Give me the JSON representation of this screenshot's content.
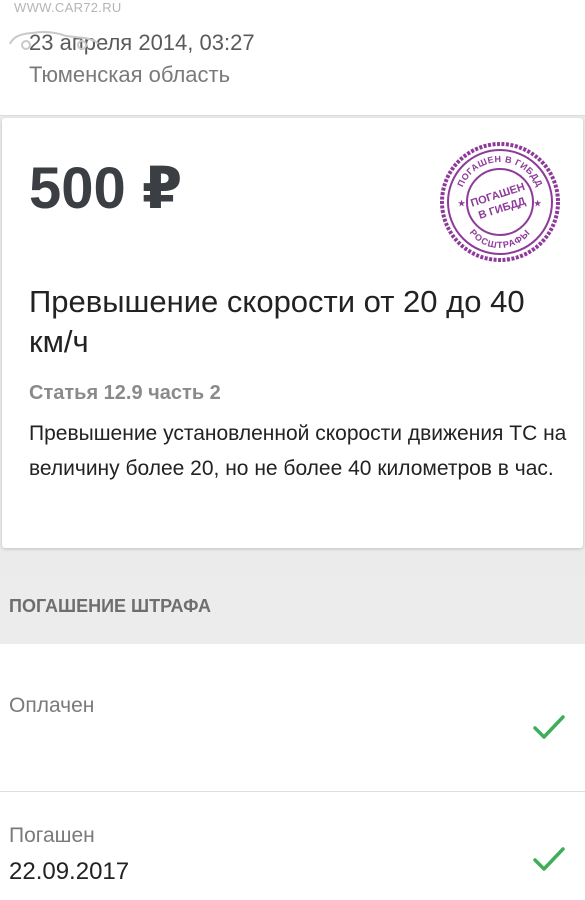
{
  "watermark": {
    "site": "WWW.CAR72.RU"
  },
  "header": {
    "date": "23 апреля 2014, 03:27",
    "region": "Тюменская область"
  },
  "fine": {
    "amount": "500 ₽",
    "title": "Превышение скорости от 20 до 40 км/ч",
    "article": "Статья 12.9 часть 2",
    "description": "Превышение установленной скорости движения ТС на величину более 20, но не более 40 километров в час.",
    "stamp": {
      "center_text": "ПОГАШЕН В ГИБДД",
      "ring_top": "ПОГАШЕН В ГИБДД",
      "ring_bottom": "РОСШТРАФЫ",
      "color": "#8e3a9a"
    }
  },
  "payment": {
    "section_title": "ПОГАШЕНИЕ ШТРАФА",
    "rows": [
      {
        "label": "Оплачен",
        "value": "",
        "status_icon": "check-icon",
        "status_color": "#3fae5a"
      },
      {
        "label": "Погашен",
        "value": "22.09.2017",
        "status_icon": "check-icon",
        "status_color": "#3fae5a"
      }
    ]
  }
}
